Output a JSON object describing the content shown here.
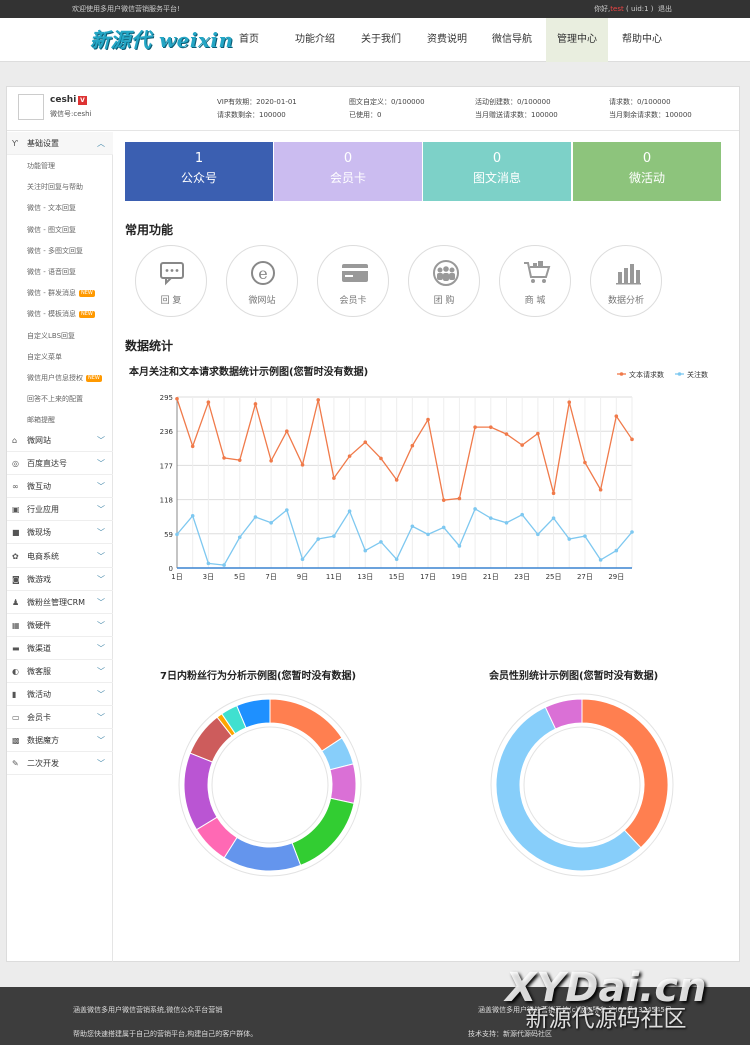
{
  "topbar": {
    "welcome": "欢迎使用多用户微信营销服务平台!",
    "hello": "你好,",
    "user": "test",
    "uid": "( uid:1 )",
    "logout": "退出"
  },
  "logo": "新源代 weixin",
  "nav": [
    {
      "label": "首页"
    },
    {
      "label": "功能介绍"
    },
    {
      "label": "关于我们"
    },
    {
      "label": "资费说明"
    },
    {
      "label": "微信导航"
    },
    {
      "label": "管理中心"
    },
    {
      "label": "帮助中心"
    }
  ],
  "account": {
    "name": "ceshi",
    "vip_badge": "V",
    "wxid": "微信号:ceshi",
    "stats": [
      {
        "label": "VIP有效期：2020-01-01"
      },
      {
        "label": "请求数剩余：100000"
      },
      {
        "label": "图文自定义：0/100000"
      },
      {
        "label": "已使用：0"
      },
      {
        "label": "活动创建数：0/100000"
      },
      {
        "label": "当月赠送请求数：100000"
      },
      {
        "label": "请求数：0/100000"
      },
      {
        "label": "当月剩余请求数：100000"
      }
    ]
  },
  "sidebar": {
    "expanded_group": {
      "label": "基础设置",
      "icon": "wrench-icon"
    },
    "subitems": [
      {
        "label": "功能管理",
        "badge": ""
      },
      {
        "label": "关注时回复与帮助",
        "badge": ""
      },
      {
        "label": "微信 - 文本回复",
        "badge": ""
      },
      {
        "label": "微信 - 图文回复",
        "badge": ""
      },
      {
        "label": "微信 - 多图文回复",
        "badge": ""
      },
      {
        "label": "微信 - 语音回复",
        "badge": ""
      },
      {
        "label": "微信 - 群发消息",
        "badge": "NEW"
      },
      {
        "label": "微信 - 模板消息",
        "badge": "NEW"
      },
      {
        "label": "自定义LBS回复",
        "badge": ""
      },
      {
        "label": "自定义菜单",
        "badge": ""
      },
      {
        "label": "微信用户信息授权",
        "badge": "NEW"
      },
      {
        "label": "回答不上来的配置",
        "badge": ""
      },
      {
        "label": "邮箱提醒",
        "badge": ""
      }
    ],
    "groups": [
      {
        "label": "微网站",
        "icon": "home-icon"
      },
      {
        "label": "百度直达号",
        "icon": "compass-icon"
      },
      {
        "label": "微互动",
        "icon": "share-icon"
      },
      {
        "label": "行业应用",
        "icon": "app-icon"
      },
      {
        "label": "微现场",
        "icon": "video-icon"
      },
      {
        "label": "电商系统",
        "icon": "gear-icon"
      },
      {
        "label": "微游戏",
        "icon": "gamepad-icon"
      },
      {
        "label": "微粉丝管理CRM",
        "icon": "users-icon"
      },
      {
        "label": "微硬件",
        "icon": "hardware-icon"
      },
      {
        "label": "微渠道",
        "icon": "channel-icon"
      },
      {
        "label": "微客服",
        "icon": "chat-icon"
      },
      {
        "label": "微活动",
        "icon": "event-icon"
      },
      {
        "label": "会员卡",
        "icon": "card-icon"
      },
      {
        "label": "数据魔方",
        "icon": "cube-icon"
      },
      {
        "label": "二次开发",
        "icon": "tools-icon"
      }
    ]
  },
  "tiles": [
    {
      "num": "1",
      "label": "公众号",
      "color": "#3b5fb1"
    },
    {
      "num": "0",
      "label": "会员卡",
      "color": "#cbbcf0"
    },
    {
      "num": "0",
      "label": "图文消息",
      "color": "#7dd1c8"
    },
    {
      "num": "0",
      "label": "微活动",
      "color": "#8dc47c"
    }
  ],
  "sections": {
    "common": "常用功能",
    "stats": "数据统计"
  },
  "functions": [
    {
      "label": "回 复",
      "icon": "chat-bubble-icon"
    },
    {
      "label": "微网站",
      "icon": "ie-icon"
    },
    {
      "label": "会员卡",
      "icon": "card-icon"
    },
    {
      "label": "团 购",
      "icon": "group-icon"
    },
    {
      "label": "商 城",
      "icon": "cart-icon"
    },
    {
      "label": "数据分析",
      "icon": "bar-chart-icon"
    }
  ],
  "footer": {
    "l1": "涵盖微信多用户微信营销系统,微信公众平台营销",
    "l2": "帮助您快速搭建属于自己的营销平台,构建自己的客户群体。",
    "r1": "涵盖微信多用户微信营销系统(c)版权所有 沪ICP备1324545号",
    "r2": "技术支持：新源代源码社区"
  },
  "watermark": {
    "line1": "XYDai.cn",
    "line2": "新源代源码社区"
  },
  "chart_data": [
    {
      "type": "line",
      "title": "本月关注和文本请求数据统计示例图(您暂时没有数据)",
      "x": [
        "1日",
        "2日",
        "3日",
        "4日",
        "5日",
        "6日",
        "7日",
        "8日",
        "9日",
        "10日",
        "11日",
        "12日",
        "13日",
        "14日",
        "15日",
        "16日",
        "17日",
        "18日",
        "19日",
        "20日",
        "21日",
        "22日",
        "23日",
        "24日",
        "25日",
        "26日",
        "27日",
        "28日",
        "29日",
        "30日"
      ],
      "xticks": [
        "1日",
        "3日",
        "5日",
        "7日",
        "9日",
        "11日",
        "13日",
        "15日",
        "17日",
        "19日",
        "21日",
        "23日",
        "25日",
        "27日",
        "29日"
      ],
      "yticks": [
        0,
        59,
        118,
        177,
        236,
        295
      ],
      "ylim": [
        0,
        295
      ],
      "grid": true,
      "legend": "top-right",
      "series": [
        {
          "name": "文本请求数",
          "color": "#f07a4a",
          "values": [
            292,
            210,
            286,
            190,
            186,
            283,
            185,
            236,
            178,
            290,
            155,
            193,
            217,
            189,
            152,
            211,
            256,
            117,
            120,
            243,
            243,
            231,
            212,
            232,
            129,
            286,
            182,
            135,
            262,
            222
          ]
        },
        {
          "name": "关注数",
          "color": "#7ec8f0",
          "values": [
            58,
            90,
            8,
            5,
            53,
            88,
            78,
            100,
            15,
            50,
            55,
            98,
            30,
            45,
            15,
            72,
            58,
            70,
            38,
            102,
            86,
            78,
            92,
            58,
            86,
            50,
            55,
            14,
            30,
            62
          ]
        }
      ]
    },
    {
      "type": "pie",
      "title": "7日内粉丝行为分析示例图(您暂时没有数据)",
      "donut": true,
      "slices": [
        {
          "value": 15,
          "color": "#ff7f50"
        },
        {
          "value": 5,
          "color": "#87cefa"
        },
        {
          "value": 7,
          "color": "#da70d6"
        },
        {
          "value": 15,
          "color": "#32cd32"
        },
        {
          "value": 14,
          "color": "#6495ed"
        },
        {
          "value": 7,
          "color": "#ff69b4"
        },
        {
          "value": 14,
          "color": "#ba55d3"
        },
        {
          "value": 8,
          "color": "#cd5c5c"
        },
        {
          "value": 1,
          "color": "#ffa500"
        },
        {
          "value": 3,
          "color": "#40e0d0"
        },
        {
          "value": 6,
          "color": "#1e90ff"
        }
      ]
    },
    {
      "type": "pie",
      "title": "会员性别统计示例图(您暂时没有数据)",
      "donut": true,
      "slices": [
        {
          "value": 38,
          "color": "#ff7f50"
        },
        {
          "value": 55,
          "color": "#87cefa"
        },
        {
          "value": 7,
          "color": "#da70d6"
        }
      ]
    }
  ]
}
